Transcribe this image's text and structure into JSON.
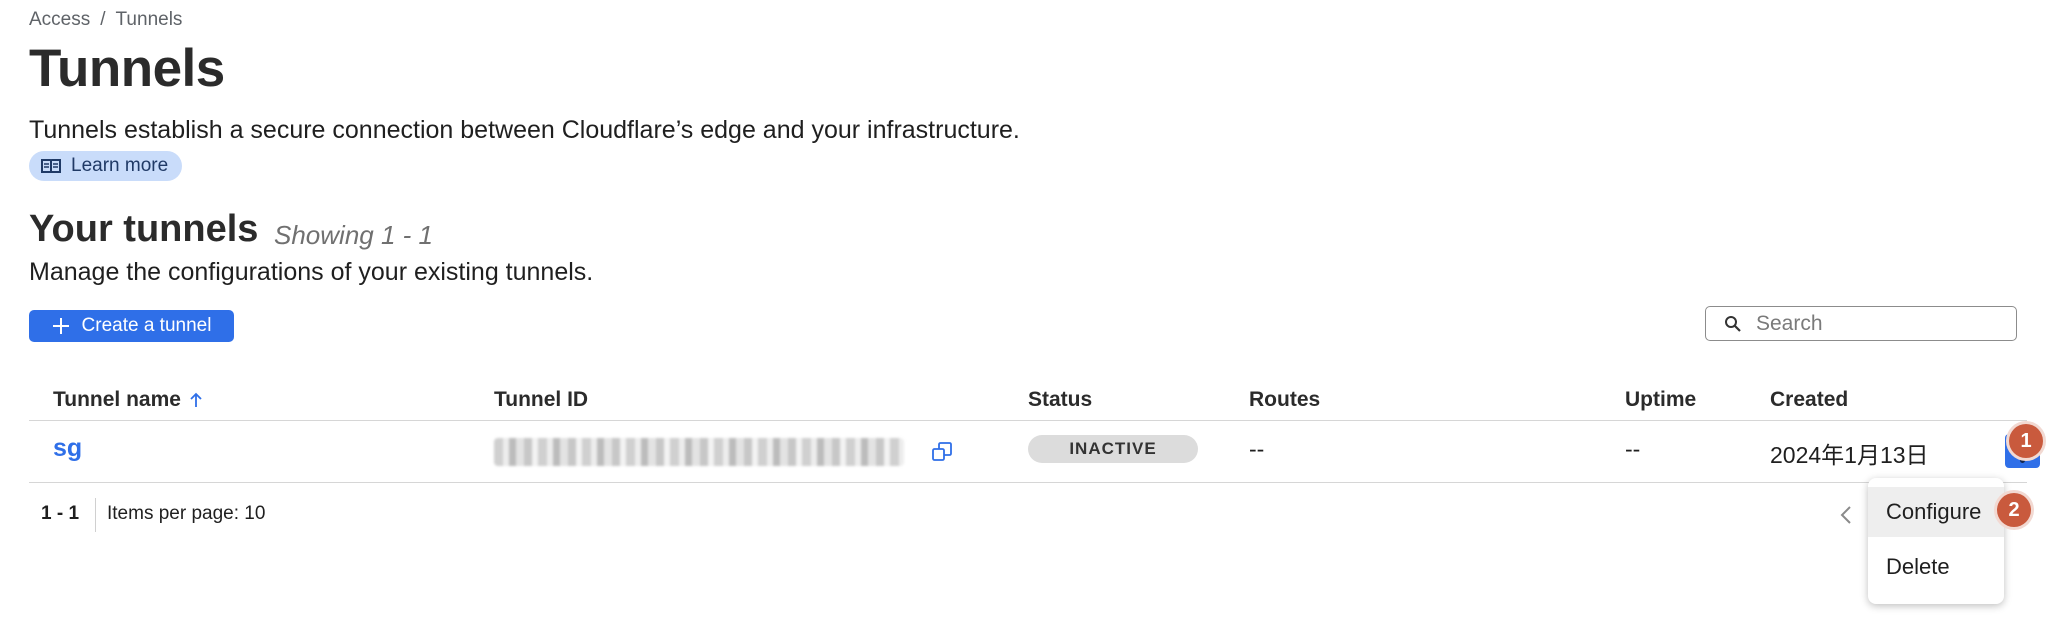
{
  "breadcrumb": {
    "items": [
      "Access",
      "Tunnels"
    ],
    "separator": "/"
  },
  "page": {
    "title": "Tunnels",
    "description": "Tunnels establish a secure connection between Cloudflare’s edge and your infrastructure.",
    "learn_more_label": "Learn more"
  },
  "section": {
    "title": "Your tunnels",
    "showing": "Showing 1 - 1",
    "description": "Manage the configurations of your existing tunnels."
  },
  "toolbar": {
    "create_label": "Create a tunnel",
    "search_placeholder": "Search"
  },
  "table": {
    "columns": [
      "Tunnel name",
      "Tunnel ID",
      "Status",
      "Routes",
      "Uptime",
      "Created"
    ],
    "sort": {
      "column": "Tunnel name",
      "direction": "ascending"
    },
    "rows": [
      {
        "name": "sg",
        "id": "",
        "id_blurred": true,
        "status": "INACTIVE",
        "routes": "--",
        "uptime": "--",
        "created": "2024年1月13日"
      }
    ]
  },
  "pagination": {
    "range": "1 - 1",
    "items_per_page": "Items per page: 10"
  },
  "row_menu": {
    "items": [
      "Configure",
      "Delete"
    ],
    "highlighted": "Configure"
  },
  "markers": [
    "1",
    "2"
  ],
  "colors": {
    "accent": "#2f6fe8",
    "learn_more_bg": "#c9dcfa",
    "marker": "#c95a3d",
    "status_inactive_bg": "#dcdcdc"
  },
  "icons": [
    "book-icon",
    "arrow-up-icon",
    "plus-icon",
    "search-icon",
    "copy-icon",
    "kebab-menu-icon",
    "chevron-left-icon"
  ]
}
